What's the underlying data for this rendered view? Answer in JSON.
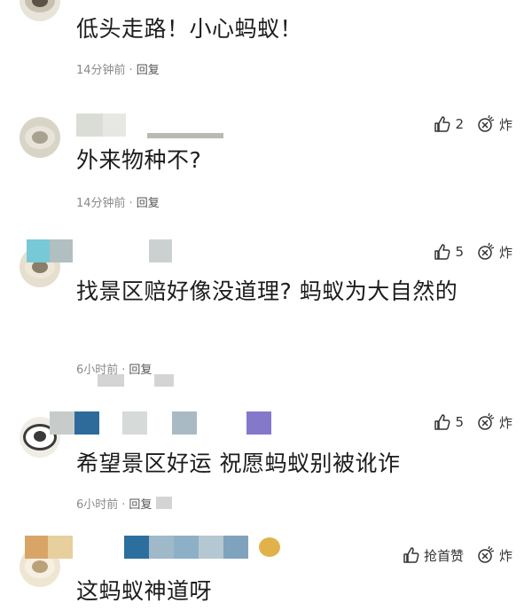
{
  "comments": [
    {
      "text": "低头走路！小心蚂蚁！",
      "time": "14分钟前",
      "reply_label": "回复",
      "likes": "",
      "bomb_label": "炸"
    },
    {
      "text": "外来物种不?",
      "time": "14分钟前",
      "reply_label": "回复",
      "likes": "2",
      "bomb_label": "炸"
    },
    {
      "text": "找景区赔好像没道理? 蚂蚁为大自然的",
      "time": "6小时前",
      "reply_label": "回复",
      "likes": "5",
      "bomb_label": "炸"
    },
    {
      "text": "希望景区好运 祝愿蚂蚁别被讹诈",
      "time": "6小时前",
      "reply_label": "回复",
      "likes": "5",
      "bomb_label": "炸"
    },
    {
      "text": "这蚂蚁神道呀",
      "time": "",
      "reply_label": "",
      "likes": "抢首赞",
      "bomb_label": "炸"
    }
  ],
  "colors": {
    "text": "#1c1c1c",
    "meta": "#8a8a8a",
    "icon": "#333333"
  },
  "icons": {
    "like": "thumbs-up-icon",
    "bomb": "bomb-icon"
  }
}
